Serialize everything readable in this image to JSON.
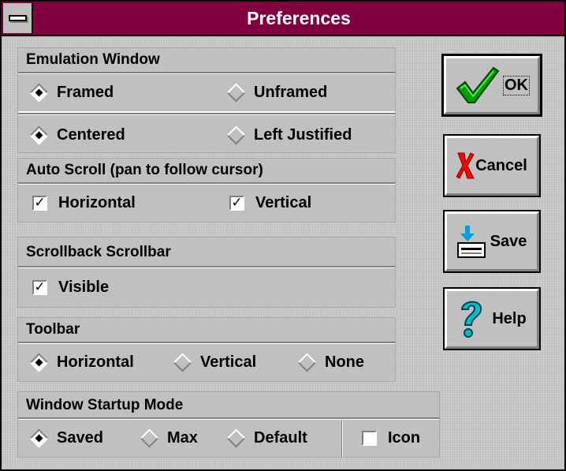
{
  "window": {
    "title": "Preferences"
  },
  "emulation_window": {
    "heading": "Emulation Window",
    "row1": [
      {
        "label": "Framed",
        "selected": true
      },
      {
        "label": "Unframed",
        "selected": false
      }
    ],
    "row2": [
      {
        "label": "Centered",
        "selected": true
      },
      {
        "label": "Left Justified",
        "selected": false
      }
    ]
  },
  "auto_scroll": {
    "heading": "Auto Scroll (pan to follow cursor)",
    "options": [
      {
        "label": "Horizontal",
        "checked": true
      },
      {
        "label": "Vertical",
        "checked": true
      }
    ]
  },
  "scrollback": {
    "heading": "Scrollback Scrollbar",
    "options": [
      {
        "label": "Visible",
        "checked": true
      }
    ]
  },
  "toolbar": {
    "heading": "Toolbar",
    "options": [
      {
        "label": "Horizontal",
        "selected": true
      },
      {
        "label": "Vertical",
        "selected": false
      },
      {
        "label": "None",
        "selected": false
      }
    ]
  },
  "startup_mode": {
    "heading": "Window Startup Mode",
    "options": [
      {
        "label": "Saved",
        "selected": true
      },
      {
        "label": "Max",
        "selected": false
      },
      {
        "label": "Default",
        "selected": false
      }
    ],
    "icon_checkbox": {
      "label": "Icon",
      "checked": false
    }
  },
  "buttons": {
    "ok": {
      "label": "OK",
      "icon": "checkmark-icon",
      "color": "#00a000"
    },
    "cancel": {
      "label": "Cancel",
      "icon": "x-icon",
      "color": "#ff0000"
    },
    "save": {
      "label": "Save",
      "icon": "disk-save-icon",
      "color": "#00a0e0"
    },
    "help": {
      "label": "Help",
      "icon": "question-icon",
      "color": "#00c0c0"
    }
  },
  "colors": {
    "titlebar": "#800040",
    "face": "#c0c0c0"
  }
}
